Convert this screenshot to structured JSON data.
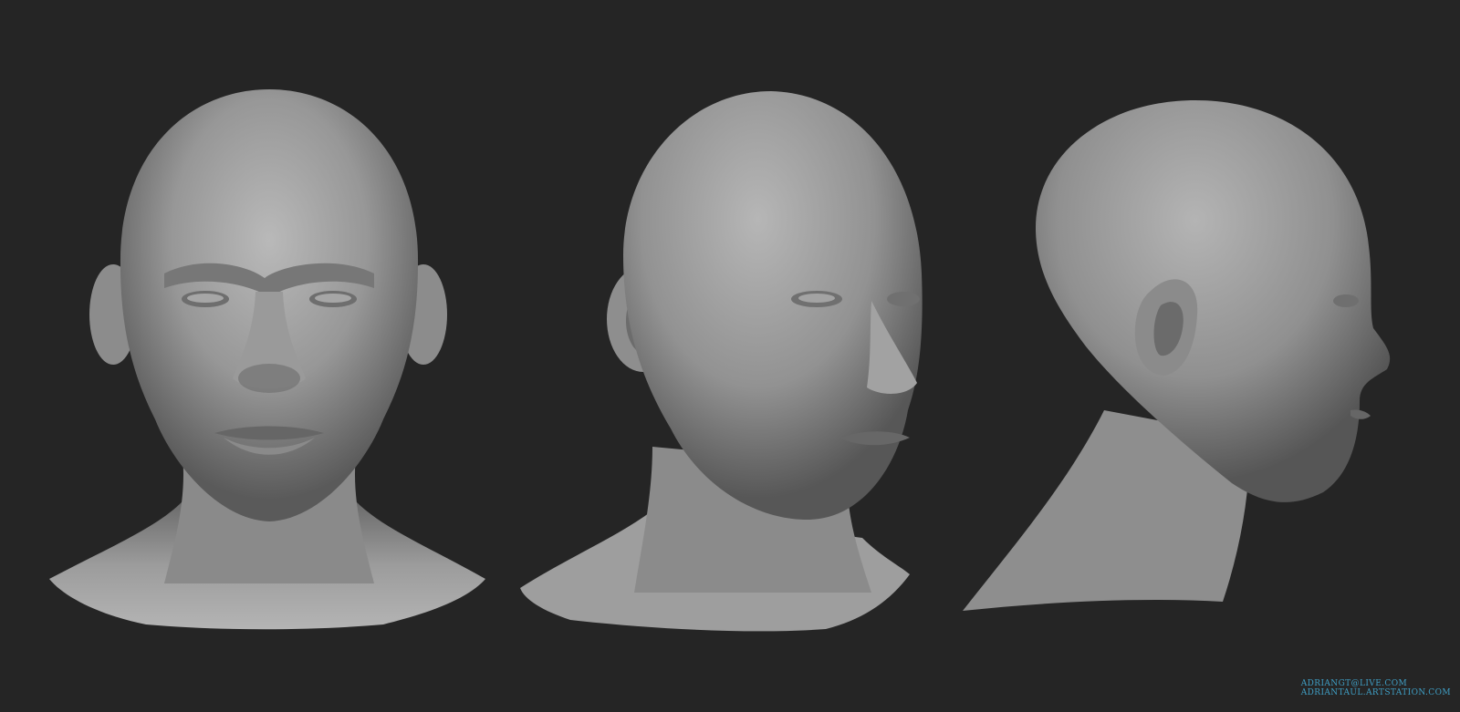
{
  "scene": {
    "background_color": "#252525",
    "model_color": "#8f8f8f",
    "views": [
      {
        "id": "front",
        "subject": "sculpted bald male head, front view"
      },
      {
        "id": "three-quarter",
        "subject": "sculpted bald male head, three-quarter view"
      },
      {
        "id": "profile",
        "subject": "sculpted bald male head, right profile view"
      }
    ]
  },
  "credits": {
    "email": "ADRIANGT@LIVE.COM",
    "website": "ADRIANTAUL.ARTSTATION.COM",
    "color": "#3f9ec4"
  }
}
